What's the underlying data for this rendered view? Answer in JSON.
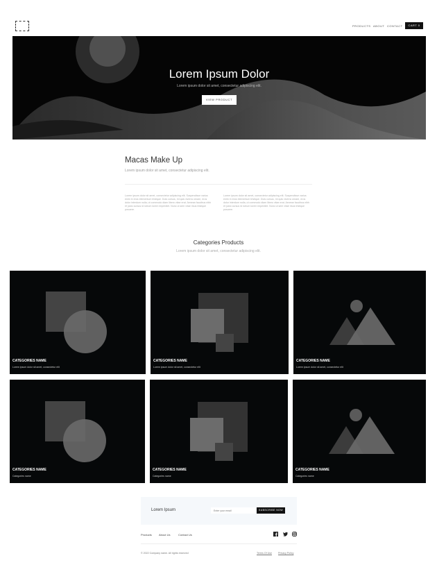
{
  "header": {
    "nav": [
      "PRODUCTS",
      "ABOUT",
      "CONTACT"
    ],
    "cart_label": "CART 0"
  },
  "hero": {
    "title": "Lorem Ipsum Dolor",
    "subtitle": "Lorem ipsum dolor sit amet, consectetur adipiscing elit.",
    "button": "VIEW PRODUCT"
  },
  "intro": {
    "title": "Macas Make Up",
    "subtitle": "Lorem ipsum dolor sit amet, consectetur adipiscing elit.",
    "paragraphs": [
      "Lorem ipsum dolor sit amet, consectetur adipiscing elit. Suspendisse varius enim in eros elementum tristique. Duis cursus, mi quis viverra ornare, eros dolor interdum nulla, ut commodo diam libero vitae erat. Aenean faucibus nibh et justo cursus id rutrum lorem imperdiet. Nunc ut sem vitae risus tristique posuere.",
      "Lorem ipsum dolor sit amet, consectetur adipiscing elit. Suspendisse varius enim in eros elementum tristique. Duis cursus, mi quis viverra ornare, eros dolor interdum nulla, ut commodo diam libero vitae erat. Aenean faucibus nibh et justo cursus id rutrum lorem imperdiet. Nunc ut sem vitae risus tristique posuere."
    ]
  },
  "categories": {
    "title": "Categories Products",
    "subtitle": "Lorem ipsum dolor sit amet, consectetur adipiscing elit.",
    "cards": [
      {
        "name": "CATEGORIES NAME",
        "desc": "Lorem ipsum dolor sit amet, consectetur elit",
        "icon": "circle-square-shape"
      },
      {
        "name": "CATEGORIES NAME",
        "desc": "Lorem ipsum dolor sit amet, consectetur elit",
        "icon": "stacked-squares-shape"
      },
      {
        "name": "CATEGORIES NAME",
        "desc": "Lorem ipsum dolor sit amet, consectetur elit",
        "icon": "mountain-image-shape"
      },
      {
        "name": "CATEGORIES NAME",
        "desc": "Categories name",
        "icon": "circle-square-shape"
      },
      {
        "name": "CATEGORIES NAME",
        "desc": "Categories name",
        "icon": "stacked-squares-shape"
      },
      {
        "name": "CATEGORIES NAME",
        "desc": "Categories name",
        "icon": "mountain-image-shape"
      }
    ]
  },
  "newsletter": {
    "title": "Lorem Ipsum",
    "placeholder": "Enter your email",
    "button": "SUBSCRIBE NOW"
  },
  "footer": {
    "links": [
      "Products",
      "About Us",
      "Contact Us"
    ],
    "social_icons": [
      "facebook-icon",
      "twitter-icon",
      "instagram-icon"
    ],
    "copyright": "© 2022 Company name. All rights reserved",
    "legal": [
      "Terms Of Use",
      "Privacy Policy"
    ]
  }
}
